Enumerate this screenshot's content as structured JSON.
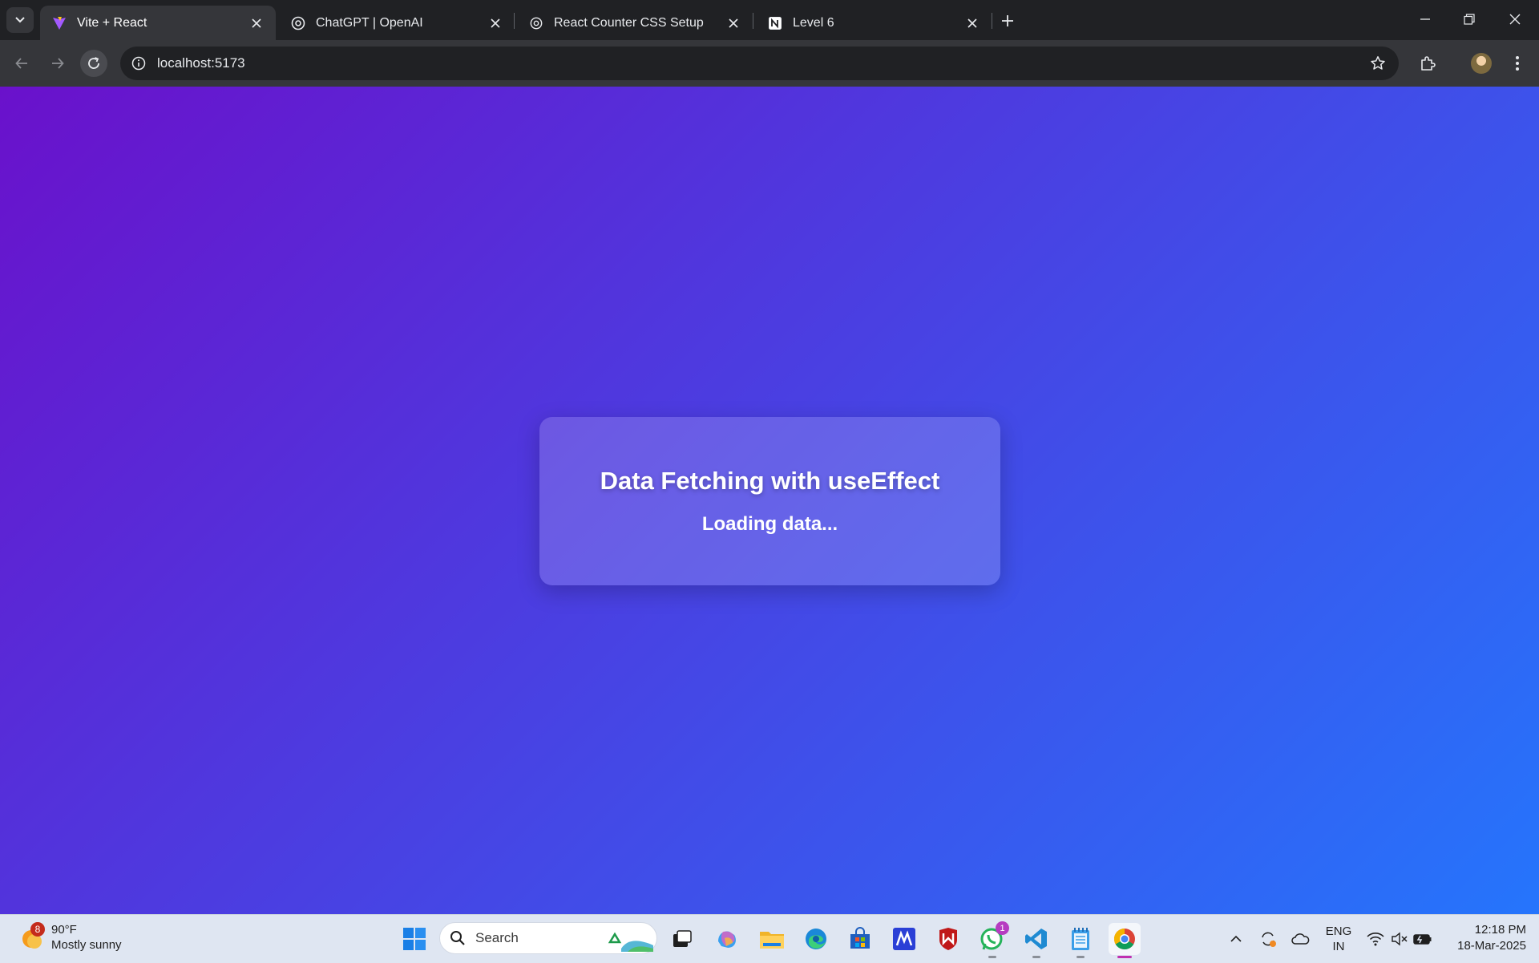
{
  "browser": {
    "tabs": [
      {
        "title": "Vite + React",
        "icon": "vite-icon",
        "active": true
      },
      {
        "title": "ChatGPT | OpenAI",
        "icon": "openai-icon",
        "active": false
      },
      {
        "title": "React Counter CSS Setup",
        "icon": "openai-icon",
        "active": false
      },
      {
        "title": "Level 6",
        "icon": "notion-icon",
        "active": false
      }
    ],
    "url": "localhost:5173"
  },
  "page": {
    "heading": "Data Fetching with useEffect",
    "status": "Loading data...",
    "gradient_start": "#6a11cb",
    "gradient_end": "#2575fc"
  },
  "taskbar": {
    "weather": {
      "temp": "90°F",
      "condition": "Mostly sunny",
      "badge": "8"
    },
    "search_placeholder": "Search",
    "whatsapp_badge": "1",
    "language": {
      "line1": "ENG",
      "line2": "IN"
    },
    "time": "12:18 PM",
    "date": "18-Mar-2025"
  }
}
